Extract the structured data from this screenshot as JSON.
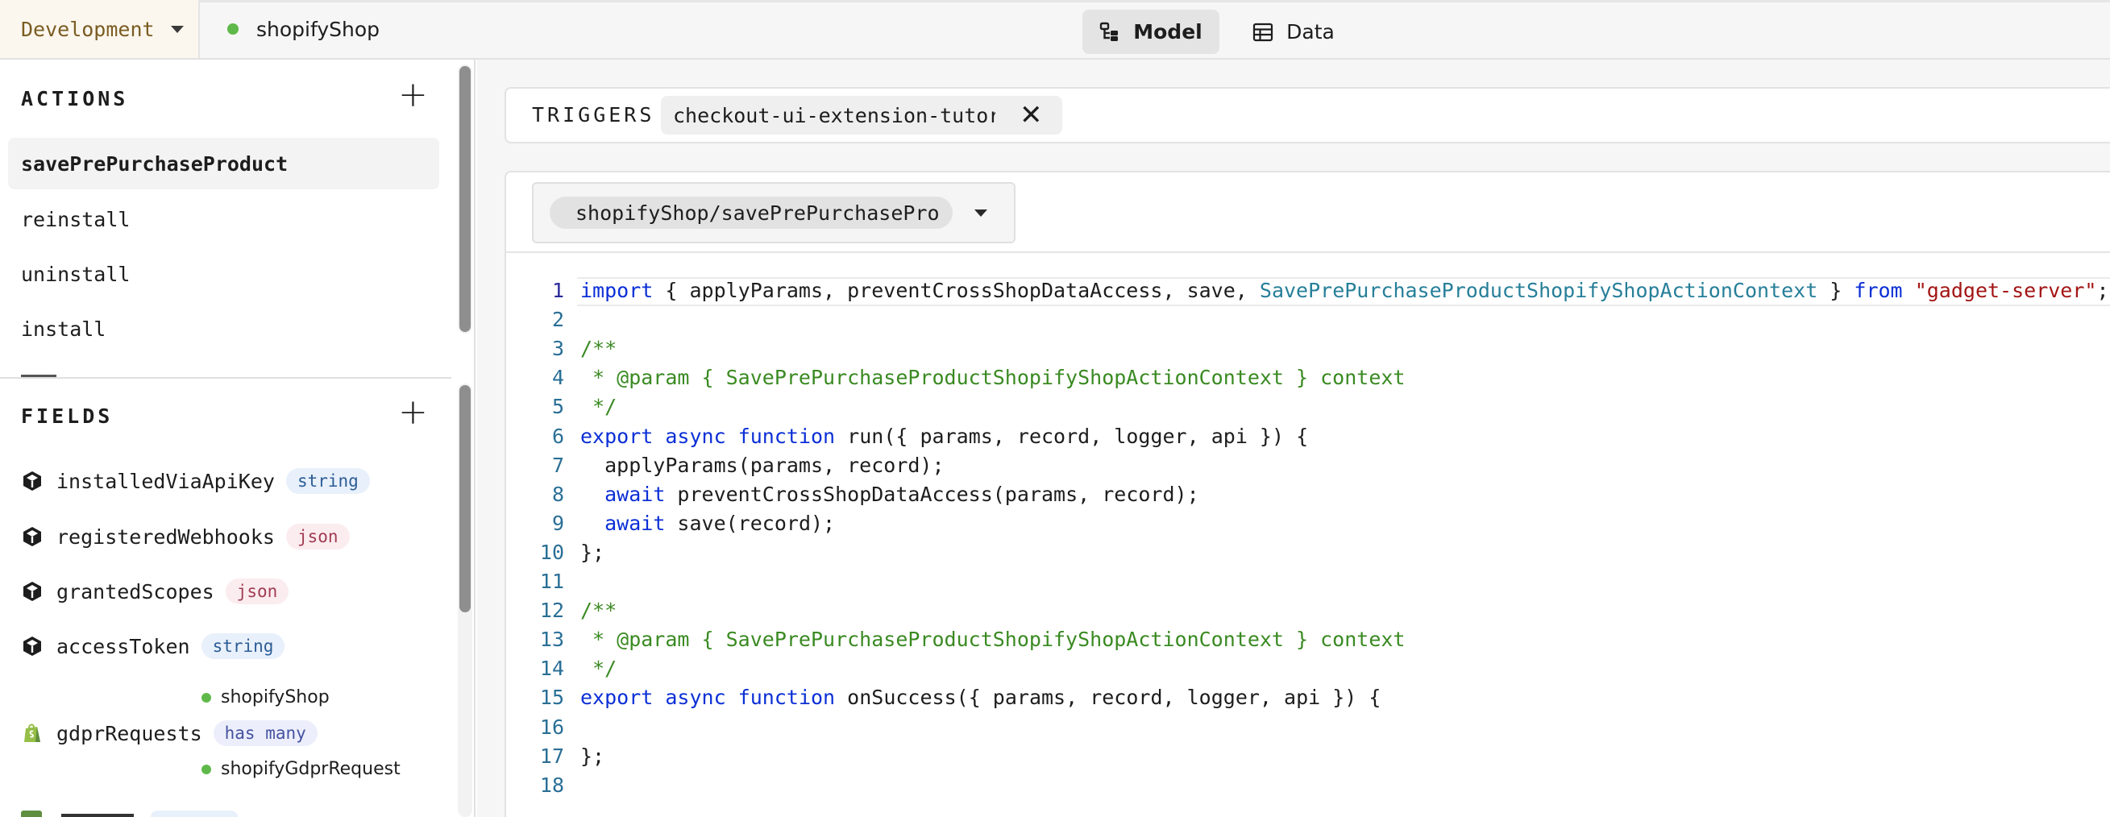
{
  "topbar": {
    "environment": "Development",
    "app_name": "shopifyShop",
    "tabs": [
      {
        "label": "Model",
        "active": true
      },
      {
        "label": "Data",
        "active": false
      }
    ]
  },
  "sidebar": {
    "actions_title": "ACTIONS",
    "actions": [
      {
        "label": "savePrePurchaseProduct",
        "selected": true
      },
      {
        "label": "reinstall"
      },
      {
        "label": "uninstall"
      },
      {
        "label": "install"
      }
    ],
    "fields_title": "FIELDS",
    "fields": [
      {
        "name": "installedViaApiKey",
        "type": "string",
        "icon": "cube-icon"
      },
      {
        "name": "registeredWebhooks",
        "type": "json",
        "icon": "cube-icon"
      },
      {
        "name": "grantedScopes",
        "type": "json",
        "icon": "cube-icon"
      },
      {
        "name": "accessToken",
        "type": "string",
        "icon": "cube-icon"
      },
      {
        "name": "gdprRequests",
        "type": "has many",
        "icon": "shopify-bag-icon",
        "relation_from": "shopifyShop",
        "relation_to": "shopifyGdprRequest"
      }
    ]
  },
  "main": {
    "triggers_label": "TRIGGERS",
    "trigger_chip": "checkout-ui-extension-tutorial",
    "file_selector": "shopifyShop/savePrePurchaseProduct.js",
    "code_lines": [
      "import { applyParams, preventCrossShopDataAccess, save, SavePrePurchaseProductShopifyShopActionContext } from \"gadget-server\";",
      "",
      "/**",
      " * @param { SavePrePurchaseProductShopifyShopActionContext } context",
      " */",
      "export async function run({ params, record, logger, api }) {",
      "  applyParams(params, record);",
      "  await preventCrossShopDataAccess(params, record);",
      "  await save(record);",
      "};",
      "",
      "/**",
      " * @param { SavePrePurchaseProductShopifyShopActionContext } context",
      " */",
      "export async function onSuccess({ params, record, logger, api }) {",
      "",
      "};",
      ""
    ]
  },
  "colors": {
    "keyword": "#0b2fd6",
    "type": "#267f99",
    "string": "#a31515",
    "comment": "#3a8a22",
    "status_dot": "#5fb94a"
  }
}
